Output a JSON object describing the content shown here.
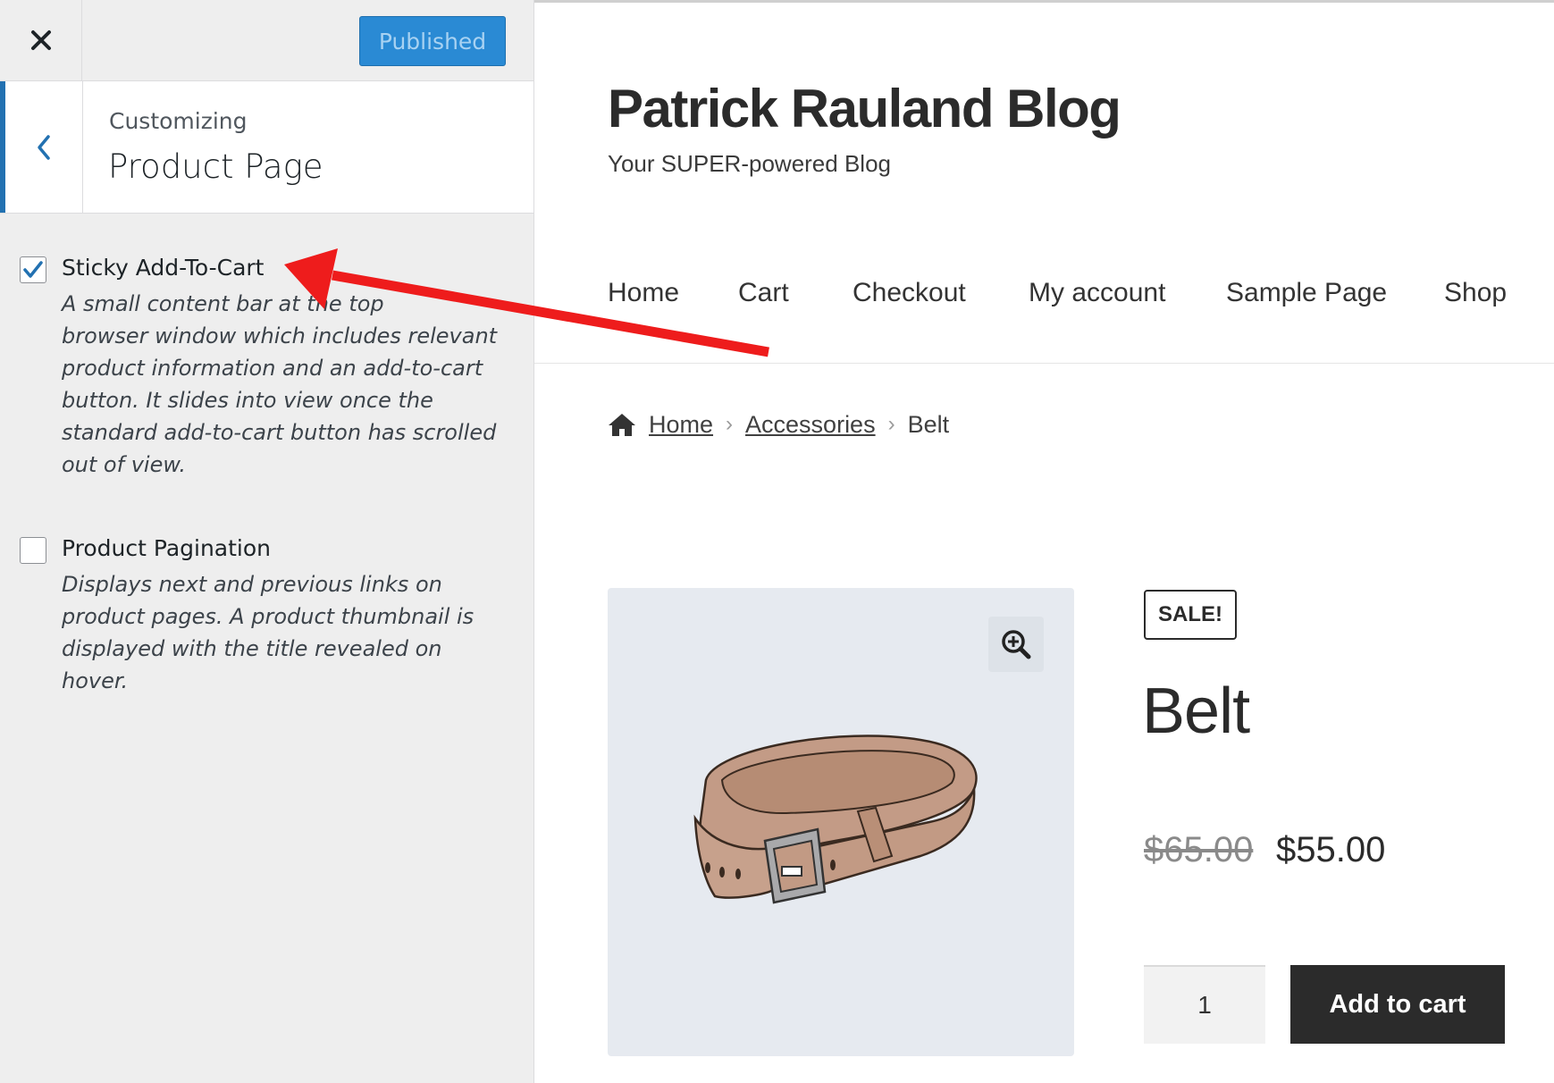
{
  "customizer": {
    "close_icon": "close-icon",
    "publish_label": "Published",
    "section_subtitle": "Customizing",
    "section_title": "Product Page",
    "back_icon": "chevron-left-icon",
    "controls": [
      {
        "label": "Sticky Add-To-Cart",
        "checked": true,
        "description_lines": [
          "A small content bar at the top",
          "browser window which includes relevant",
          "product information and an add-to-cart",
          "button. It slides into view once the",
          "standard add-to-cart button has scrolled",
          "out of view."
        ]
      },
      {
        "label": "Product Pagination",
        "checked": false,
        "description_lines": [
          "Displays next and previous links on",
          "product pages. A product thumbnail is",
          "displayed with the title revealed on",
          "hover."
        ]
      }
    ]
  },
  "site": {
    "title": "Patrick Rauland Blog",
    "tagline": "Your SUPER-powered Blog",
    "nav": [
      "Home",
      "Cart",
      "Checkout",
      "My account",
      "Sample Page",
      "Shop"
    ],
    "breadcrumb": {
      "home_icon": "home-icon",
      "items": [
        "Home",
        "Accessories",
        "Belt"
      ]
    },
    "product": {
      "sale_badge": "SALE!",
      "title": "Belt",
      "price_old": "$65.00",
      "price_new": "$55.00",
      "quantity": "1",
      "add_to_cart": "Add to cart",
      "image_icon": "belt-image",
      "zoom_icon": "zoom-in-icon"
    }
  },
  "annotation": {
    "arrow_color": "#ee1c1c",
    "arrow_icon": "arrow-annotation"
  }
}
